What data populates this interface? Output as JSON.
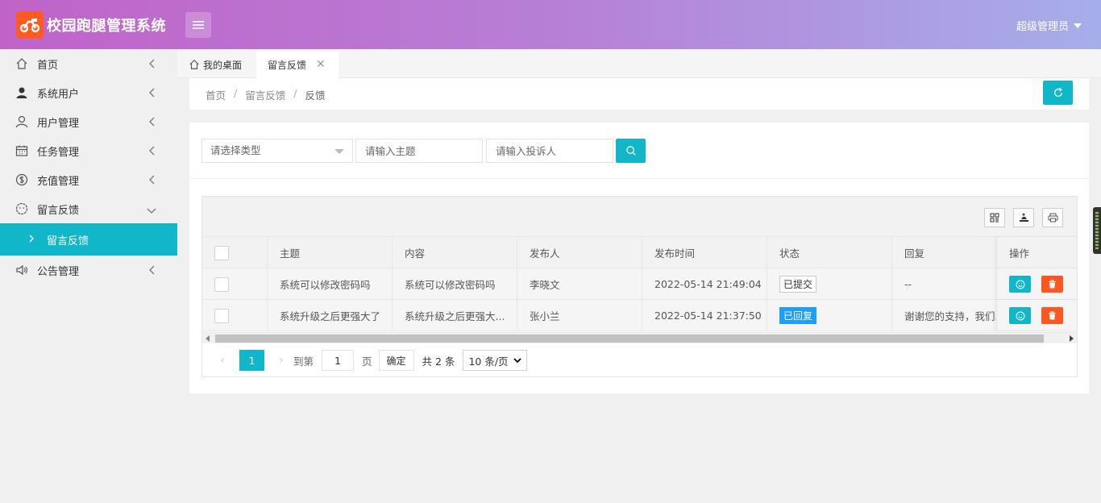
{
  "app": {
    "title": "校园跑腿管理系统"
  },
  "header": {
    "user_name": "超级管理员"
  },
  "sidebar": {
    "items": [
      {
        "label": "首页",
        "icon": "home-icon"
      },
      {
        "label": "系统用户",
        "icon": "person-filled-icon"
      },
      {
        "label": "用户管理",
        "icon": "user-icon"
      },
      {
        "label": "任务管理",
        "icon": "calendar-icon"
      },
      {
        "label": "充值管理",
        "icon": "dollar-icon"
      },
      {
        "label": "留言反馈",
        "icon": "smile-icon"
      },
      {
        "label": "公告管理",
        "icon": "speaker-icon"
      }
    ],
    "active_sub": {
      "label": "留言反馈"
    }
  },
  "tabs": {
    "home": "我的桌面",
    "active": "留言反馈"
  },
  "breadcrumb": {
    "home": "首页",
    "parent": "留言反馈",
    "current": "反馈"
  },
  "search": {
    "type_placeholder": "请选择类型",
    "subject_placeholder": "请输入主题",
    "complainant_placeholder": "请输入投诉人"
  },
  "table": {
    "columns": [
      "主题",
      "内容",
      "发布人",
      "发布时间",
      "状态",
      "回复",
      "操作"
    ],
    "rows": [
      {
        "subject": "系统可以修改密码吗",
        "content": "系统可以修改密码吗",
        "author": "李晓文",
        "time": "2022-05-14 21:49:04",
        "status": "已提交",
        "reply": "--"
      },
      {
        "subject": "系统升级之后更强大了",
        "content": "系统升级之后更强大...",
        "author": "张小兰",
        "time": "2022-05-14 21:37:50",
        "status": "已回复",
        "reply": "谢谢您的支持，我们..."
      }
    ]
  },
  "pagination": {
    "current_page": "1",
    "goto_label": "到第",
    "goto_value": "1",
    "page_unit": "页",
    "confirm_label": "确定",
    "total_label": "共 2 条",
    "page_size": "10 条/页"
  },
  "colors": {
    "accent": "#11b6c8",
    "danger": "#ff5722",
    "status_blue": "#1e9fff",
    "logo": "#ff5a1f"
  }
}
